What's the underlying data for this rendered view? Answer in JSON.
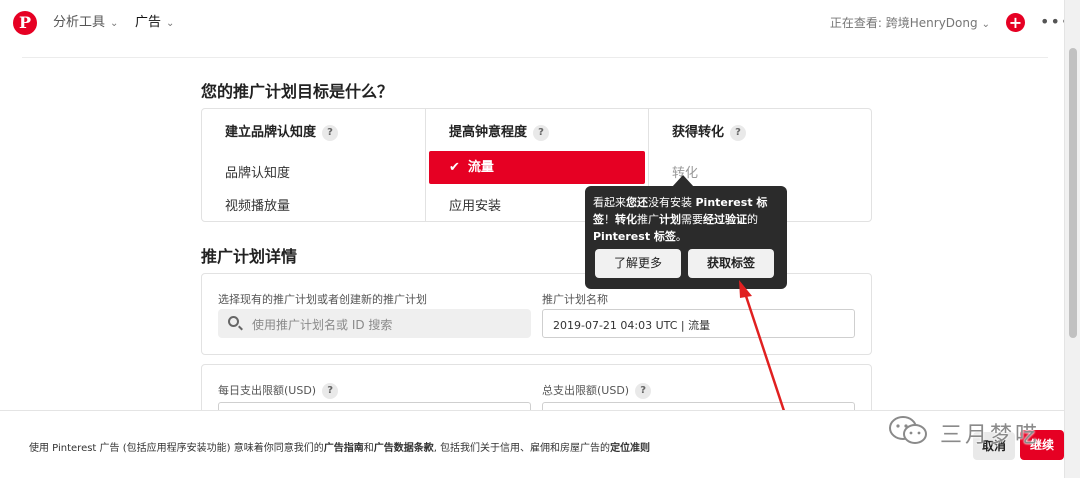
{
  "colors": {
    "brand": "#e60023",
    "tooltip_bg": "#2b2b2b",
    "annotation": "#e02020"
  },
  "topbar": {
    "logo": "P",
    "logo_icon": "pinterest-logo-icon",
    "nav": [
      {
        "label": "分析工具"
      },
      {
        "label": "广告"
      }
    ],
    "viewing_label": "正在查看: 跨境HenryDong",
    "plus_icon": "plus-icon",
    "more_icon": "more-dots-icon",
    "plus": "+",
    "more": "•••"
  },
  "objective": {
    "title": "您的推广计划目标是什么？",
    "columns": [
      {
        "heading": "建立品牌认知度",
        "options": [
          "品牌认知度",
          "视频播放量"
        ]
      },
      {
        "heading": "提高钟意程度",
        "options": [
          "流量",
          "应用安装"
        ]
      },
      {
        "heading": "获得转化",
        "options": [
          "转化"
        ]
      }
    ],
    "selected_option": "流量",
    "check_mark": "✔",
    "help": "?"
  },
  "tooltip": {
    "text_html": "看起来<b>您还</b>没有安装 <b>Pinterest 标签</b>！<b>转化</b>推广<b>计划</b>需要<b>经过验证</b>的 <b>Pinterest 标签</b>。",
    "learn_more": "了解更多",
    "get_tag": "获取标签"
  },
  "details": {
    "title": "推广计划详情",
    "existing_label": "选择现有的推广计划或者创建新的推广计划",
    "search_placeholder": "使用推广计划名或 ID 搜索",
    "name_label": "推广计划名称",
    "name_value": "2019-07-21 04:03 UTC | 流量",
    "daily_budget_label": "每日支出限额(USD)",
    "lifetime_budget_label": "总支出限额(USD)"
  },
  "footer": {
    "text_html": "使用 Pinterest 广告 (包括应用程序安装功能) 意味着你同意我们的<b>广告指南</b>和<b>广告数据条款</b>, 包括我们关于信用、雇佣和房屋广告的<b>定位准则</b>",
    "cancel": "取消",
    "continue": "继续"
  },
  "watermark": {
    "text": "三月梦呓",
    "icon": "wechat-icon"
  }
}
